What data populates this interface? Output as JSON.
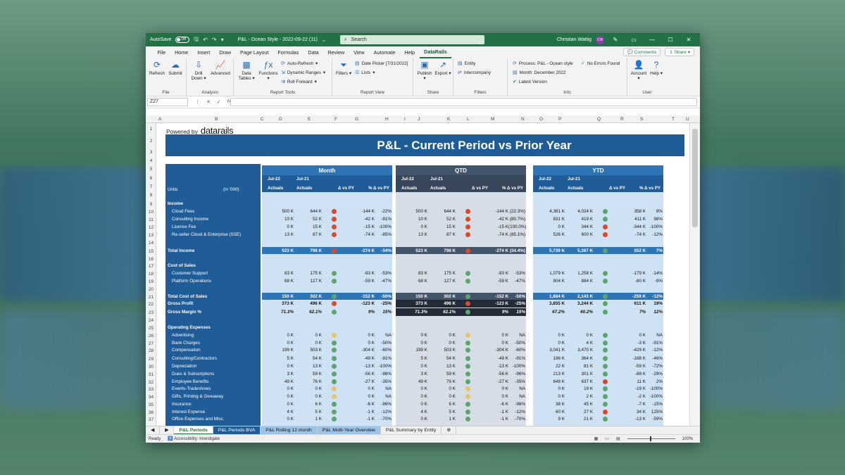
{
  "titlebar": {
    "autosave": "AutoSave",
    "autosave_state": "Off",
    "doc_title": "P&L - Ocean Style - 2022-09-22 (11)",
    "search_placeholder": "Search",
    "user": "Christian Wattig",
    "user_initials": "CW"
  },
  "menu": {
    "items": [
      "File",
      "Home",
      "Insert",
      "Draw",
      "Page Layout",
      "Formulas",
      "Data",
      "Review",
      "View",
      "Automate",
      "Help",
      "DataRails"
    ],
    "active": "DataRails",
    "comments": "Comments",
    "share": "Share"
  },
  "ribbon": {
    "file": {
      "refresh": "Refresh",
      "submit": "Submit",
      "group": "File"
    },
    "analysis": {
      "drill": "Drill",
      "down": "Down",
      "advanced": "Advanced",
      "group": "Analysis"
    },
    "report_tools": {
      "data": "Data",
      "tables": "Tables",
      "functions": "Functions",
      "auto_refresh": "Auto-Refresh",
      "dynamic_ranges": "Dynamic Ranges",
      "roll_forward": "Roll Forward",
      "group": "Report Tools"
    },
    "report_view": {
      "filters": "Filters",
      "date_picker": "Date Picker [7/31/2022]",
      "lists": "Lists",
      "group": "Report View"
    },
    "share": {
      "publish": "Publish",
      "export": "Export",
      "group": "Share"
    },
    "filters": {
      "entity": "Entity",
      "intercompany": "Intercompany",
      "group": "Filters"
    },
    "info": {
      "process": "Process: P&L - Ocean style",
      "month": "Month: December 2022",
      "latest": "Latest Version",
      "no_errors": "No Errors Found",
      "group": "Info"
    },
    "user": {
      "account": "Account",
      "help": "Help",
      "group": "User"
    }
  },
  "formula": {
    "cell_ref": "Z27",
    "fx": "fx"
  },
  "columns": [
    "A",
    "B",
    "C",
    "D",
    "E",
    "F",
    "G",
    "H",
    "I",
    "J",
    "K",
    "L",
    "M",
    "N",
    "O",
    "P",
    "Q",
    "R",
    "S",
    "T",
    "U"
  ],
  "rows": [
    "1",
    "2",
    "3",
    "4",
    "5",
    "6",
    "7",
    "8",
    "9",
    "10",
    "11",
    "12",
    "13",
    "14",
    "15",
    "16",
    "17",
    "18",
    "19",
    "20",
    "21",
    "22",
    "23",
    "24",
    "25",
    "26",
    "27",
    "28",
    "29",
    "30",
    "31",
    "32",
    "33",
    "34",
    "35",
    "36",
    "37"
  ],
  "sheet": {
    "powered_by": "Powered by",
    "brand": "datarails",
    "title": "P&L  -  Current Period vs Prior Year",
    "units": "Units",
    "in000": "(in '000)",
    "blocks": [
      {
        "name": "Month",
        "color": "#2e75b6",
        "bg": "#cfe2f3",
        "y1": "Jul-22",
        "y2": "Jul-21",
        "a1": "Actuals",
        "a2": "Actuals",
        "d": "Δ vs PY",
        "p": "% Δ vs PY"
      },
      {
        "name": "QTD",
        "color": "#44546a",
        "bg": "#d6dde6",
        "y1": "Jul-22",
        "y2": "Jul-21",
        "a1": "Actuals",
        "a2": "Actuals",
        "d": "Δ vs PY",
        "p": "% Δ vs PY"
      },
      {
        "name": "YTD",
        "color": "#2e75b6",
        "bg": "#cfe2f3",
        "y1": "Jul-22",
        "y2": "Jul-21",
        "a1": "Actuals",
        "a2": "Actuals",
        "d": "Δ vs PY",
        "p": "% Δ vs PY"
      }
    ],
    "lines": [
      {
        "label": "Income",
        "type": "section"
      },
      {
        "label": "Cloud Fees",
        "m": [
          "500 K",
          "644 K",
          "r",
          "-144 K",
          "-22%"
        ],
        "q": [
          "500 K",
          "644 K",
          "r",
          "-144 K",
          "(22.3%)"
        ],
        "y": [
          "4,381 K",
          "4,024 K",
          "g",
          "358 K",
          "9%"
        ]
      },
      {
        "label": "Consulting Income",
        "m": [
          "10 K",
          "52 K",
          "r",
          "-42 K",
          "-81%"
        ],
        "q": [
          "10 K",
          "52 K",
          "r",
          "-42 K",
          "(80.7%)"
        ],
        "y": [
          "831 K",
          "419 K",
          "g",
          "411 K",
          "98%"
        ]
      },
      {
        "label": "License Fee",
        "m": [
          "0 K",
          "15 K",
          "r",
          "-15 K",
          "-100%"
        ],
        "q": [
          "0 K",
          "15 K",
          "r",
          "-15 K",
          "(100.0%)"
        ],
        "y": [
          "0 K",
          "344 K",
          "r",
          "-344 K",
          "-100%"
        ]
      },
      {
        "label": "Re-seller Cloud & Enterprise (SSE)",
        "m": [
          "13 K",
          "87 K",
          "r",
          "-74 K",
          "-85%"
        ],
        "q": [
          "13 K",
          "87 K",
          "r",
          "-74 K",
          "(85.1%)"
        ],
        "y": [
          "526 K",
          "600 K",
          "r",
          "-74 K",
          "-12%"
        ]
      },
      {
        "label": "",
        "type": "blank"
      },
      {
        "label": "Total Income",
        "type": "total",
        "m": [
          "523 K",
          "798 K",
          "r",
          "-274 K",
          "-34%"
        ],
        "q": [
          "523 K",
          "798 K",
          "r",
          "-274 K",
          "(34.4%)"
        ],
        "y": [
          "5,739 K",
          "5,387 K",
          "g",
          "352 K",
          "7%"
        ]
      },
      {
        "label": "",
        "type": "blank"
      },
      {
        "label": "Cost of Sales",
        "type": "section"
      },
      {
        "label": "Customer Support",
        "m": [
          "83 K",
          "175 K",
          "g",
          "-93 K",
          "-53%"
        ],
        "q": [
          "83 K",
          "175 K",
          "g",
          "-93 K",
          "-53%"
        ],
        "y": [
          "1,079 K",
          "1,258 K",
          "g",
          "-179 K",
          "-14%"
        ]
      },
      {
        "label": "Platform Operations",
        "m": [
          "68 K",
          "127 K",
          "g",
          "-59 K",
          "-47%"
        ],
        "q": [
          "68 K",
          "127 K",
          "g",
          "-59 K",
          "-47%"
        ],
        "y": [
          "804 K",
          "884 K",
          "g",
          "-80 K",
          "-9%"
        ]
      },
      {
        "label": "",
        "type": "blank"
      },
      {
        "label": "Total Cost of Sales",
        "type": "total",
        "m": [
          "150 K",
          "302 K",
          "g",
          "-152 K",
          "-50%"
        ],
        "q": [
          "150 K",
          "302 K",
          "g",
          "-152 K",
          "-50%"
        ],
        "y": [
          "1,884 K",
          "2,143 K",
          "g",
          "-259 K",
          "-12%"
        ]
      },
      {
        "label": "Gross Profit",
        "type": "gp",
        "m": [
          "373 K",
          "496 K",
          "r",
          "-123 K",
          "-25%"
        ],
        "q": [
          "373 K",
          "496 K",
          "r",
          "-123 K",
          "-25%"
        ],
        "y": [
          "3,855 K",
          "3,244 K",
          "g",
          "611 K",
          "19%"
        ]
      },
      {
        "label": "Gross Margin %",
        "type": "gm",
        "m": [
          "71.3%",
          "62.1%",
          "g",
          "9%",
          "15%"
        ],
        "q": [
          "71.3%",
          "62.1%",
          "g",
          "9%",
          "15%"
        ],
        "y": [
          "67.2%",
          "60.2%",
          "g",
          "7%",
          "12%"
        ]
      },
      {
        "label": "",
        "type": "blank"
      },
      {
        "label": "Operating Expenses",
        "type": "section"
      },
      {
        "label": "Advertising",
        "m": [
          "0 K",
          "0 K",
          "y",
          "0 K",
          "NA"
        ],
        "q": [
          "0 K",
          "0 K",
          "y",
          "0 K",
          "NA"
        ],
        "y": [
          "0 K",
          "0 K",
          "g",
          "0 K",
          "NA"
        ]
      },
      {
        "label": "Bank Charges",
        "m": [
          "0 K",
          "0 K",
          "g",
          "0 K",
          "-50%"
        ],
        "q": [
          "0 K",
          "0 K",
          "g",
          "0 K",
          "-50%"
        ],
        "y": [
          "0 K",
          "4 K",
          "g",
          "-3 K",
          "-91%"
        ]
      },
      {
        "label": "Compensation",
        "m": [
          "199 K",
          "503 K",
          "g",
          "-304 K",
          "-60%"
        ],
        "q": [
          "199 K",
          "503 K",
          "g",
          "-304 K",
          "-60%"
        ],
        "y": [
          "3,041 K",
          "3,470 K",
          "g",
          "-429 K",
          "-12%"
        ]
      },
      {
        "label": "Consulting/Contractors",
        "m": [
          "5 K",
          "54 K",
          "g",
          "-49 K",
          "-91%"
        ],
        "q": [
          "5 K",
          "54 K",
          "g",
          "-49 K",
          "-91%"
        ],
        "y": [
          "196 K",
          "364 K",
          "g",
          "-168 K",
          "-46%"
        ]
      },
      {
        "label": "Depreciation",
        "m": [
          "0 K",
          "13 K",
          "g",
          "-13 K",
          "-100%"
        ],
        "q": [
          "0 K",
          "13 K",
          "g",
          "-13 K",
          "-100%"
        ],
        "y": [
          "22 K",
          "81 K",
          "g",
          "-59 K",
          "-72%"
        ]
      },
      {
        "label": "Dues & Subscriptions",
        "m": [
          "3 K",
          "59 K",
          "g",
          "-56 K",
          "-96%"
        ],
        "q": [
          "3 K",
          "59 K",
          "g",
          "-56 K",
          "-96%"
        ],
        "y": [
          "213 K",
          "301 K",
          "g",
          "-88 K",
          "-29%"
        ]
      },
      {
        "label": "Employee Benefits",
        "m": [
          "49 K",
          "76 K",
          "g",
          "-27 K",
          "-35%"
        ],
        "q": [
          "49 K",
          "76 K",
          "g",
          "-27 K",
          "-35%"
        ],
        "y": [
          "648 K",
          "637 K",
          "r",
          "11 K",
          "2%"
        ]
      },
      {
        "label": "Events-Tradeshows",
        "m": [
          "0 K",
          "0 K",
          "y",
          "0 K",
          "NA"
        ],
        "q": [
          "0 K",
          "0 K",
          "y",
          "0 K",
          "NA"
        ],
        "y": [
          "0 K",
          "19 K",
          "g",
          "-19 K",
          "-100%"
        ]
      },
      {
        "label": "Gifts, Printing & Giveaway",
        "m": [
          "0 K",
          "0 K",
          "y",
          "0 K",
          "NA"
        ],
        "q": [
          "0 K",
          "0 K",
          "y",
          "0 K",
          "NA"
        ],
        "y": [
          "0 K",
          "2 K",
          "g",
          "-2 K",
          "-100%"
        ]
      },
      {
        "label": "Insurance",
        "m": [
          "0 K",
          "6 K",
          "g",
          "-6 K",
          "-96%"
        ],
        "q": [
          "0 K",
          "6 K",
          "g",
          "-6 K",
          "-96%"
        ],
        "y": [
          "38 K",
          "45 K",
          "g",
          "-7 K",
          "-15%"
        ]
      },
      {
        "label": "Interest Expense",
        "m": [
          "4 K",
          "5 K",
          "g",
          "-1 K",
          "-12%"
        ],
        "q": [
          "4 K",
          "5 K",
          "g",
          "-1 K",
          "-12%"
        ],
        "y": [
          "60 K",
          "27 K",
          "r",
          "34 K",
          "125%"
        ]
      },
      {
        "label": "Office Expenses and Misc.",
        "m": [
          "0 K",
          "1 K",
          "g",
          "-1 K",
          "-70%"
        ],
        "q": [
          "0 K",
          "1 K",
          "g",
          "-1 K",
          "-70%"
        ],
        "y": [
          "9 K",
          "21 K",
          "g",
          "-13 K",
          "-59%"
        ]
      }
    ]
  },
  "tabs": [
    {
      "label": "P&L Periods",
      "active": true
    },
    {
      "label": "P&L Periods BVA"
    },
    {
      "label": "P&L Rolling 12 month"
    },
    {
      "label": "P&L Multi-Year Overview"
    },
    {
      "label": "P&L Summary by Entity"
    }
  ],
  "status": {
    "ready": "Ready",
    "accessibility": "Accessibility: Investigate",
    "zoom": "100%"
  },
  "colors": {
    "excel_green": "#217346",
    "title_blue": "#1e5c97",
    "red": "#d94a2b",
    "green": "#5aa66e",
    "yellow": "#e8c36a"
  }
}
